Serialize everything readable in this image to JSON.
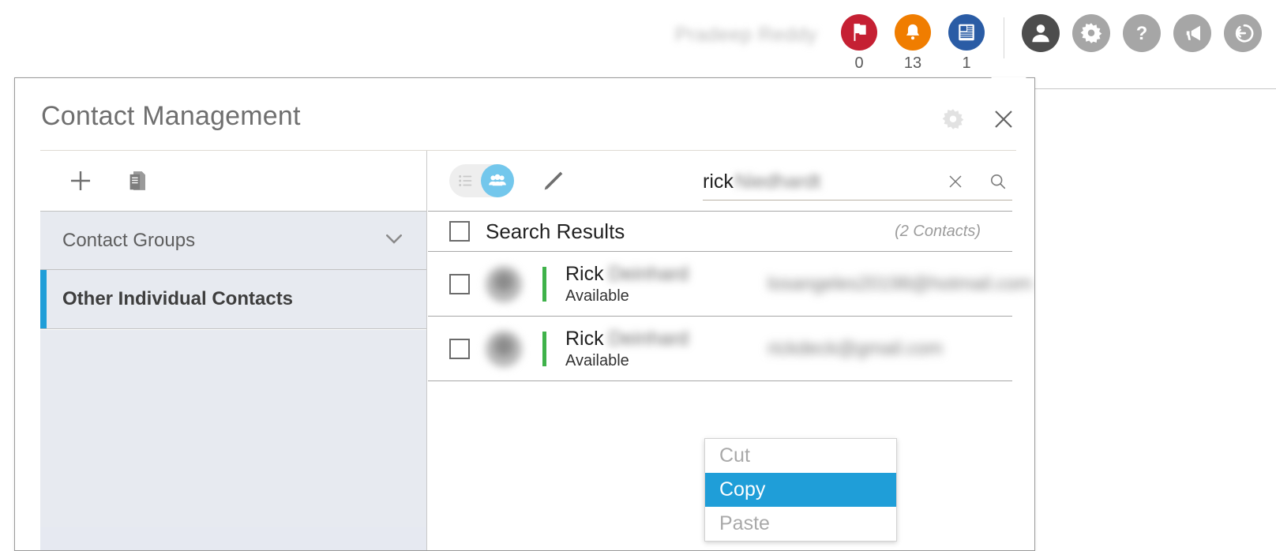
{
  "topbar": {
    "user_name": "Pradeep Reddy",
    "badges": [
      {
        "name": "flag",
        "icon": "flag-icon",
        "count": "0",
        "color": "#c52033"
      },
      {
        "name": "alerts",
        "icon": "bell-icon",
        "count": "13",
        "color": "#f07d00"
      },
      {
        "name": "voicemail",
        "icon": "keypad-icon",
        "count": "1",
        "color": "#2a5ca5"
      }
    ],
    "icons": [
      {
        "name": "profile-icon",
        "color": "#4d4d4d"
      },
      {
        "name": "settings-gear-icon",
        "color": "#a6a6a6"
      },
      {
        "name": "help-question-icon",
        "color": "#a6a6a6"
      },
      {
        "name": "announcement-megaphone-icon",
        "color": "#a6a6a6"
      },
      {
        "name": "sign-out-icon",
        "color": "#a6a6a6"
      }
    ]
  },
  "panel": {
    "title": "Contact Management",
    "gear_label": "Settings",
    "close_label": "Close"
  },
  "sidebar": {
    "toolbar": [
      {
        "name": "add-contact-group-button",
        "icon": "plus-icon"
      },
      {
        "name": "copy-list-button",
        "icon": "copy-document-icon"
      }
    ],
    "group_header": {
      "label": "Contact Groups",
      "chevron": "chevron-down-icon"
    },
    "items": [
      {
        "label": "Other Individual Contacts",
        "selected": true
      }
    ]
  },
  "main": {
    "view_toggle": {
      "list_icon": "list-view-icon",
      "group_icon": "group-view-icon",
      "active": "group"
    },
    "edit_button": {
      "name": "edit-pencil-button",
      "icon": "pencil-icon"
    },
    "search": {
      "value": "rick",
      "value_redacted": "Niedhardt",
      "clear_icon": "clear-x-icon",
      "search_icon": "magnifier-icon"
    },
    "results": {
      "header_label": "Search Results",
      "count_label": "(2 Contacts)",
      "select_all_checked": false
    },
    "contacts": [
      {
        "first_name": "Rick",
        "last_name_redacted": "Deinhard",
        "status": "Available",
        "presence_color": "#3fb24a",
        "email_redacted": "losangeles20198@hotmail.com",
        "checked": false
      },
      {
        "first_name": "Rick",
        "last_name_redacted": "Deinhard",
        "status": "Available",
        "presence_color": "#3fb24a",
        "email_redacted": "rickdeck@gmail.com",
        "checked": false
      }
    ]
  },
  "context_menu": {
    "items": [
      {
        "label": "Cut",
        "enabled": false
      },
      {
        "label": "Copy",
        "enabled": true
      },
      {
        "label": "Paste",
        "enabled": false
      }
    ],
    "highlight_color": "#1f9ed8"
  }
}
